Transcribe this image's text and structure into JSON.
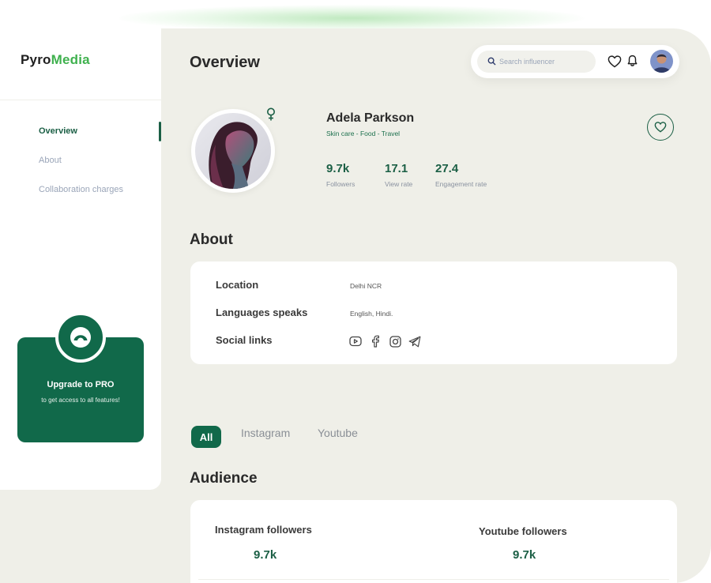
{
  "app": {
    "logo_part1": "Pyro",
    "logo_part2": "Media"
  },
  "sidebar": {
    "items": [
      {
        "label": "Overview",
        "active": true
      },
      {
        "label": "About",
        "active": false
      },
      {
        "label": "Collaboration  charges",
        "active": false
      }
    ],
    "promo": {
      "title": "Upgrade to PRO",
      "subtitle": "to get access to all features!",
      "icon": "logo-mark-icon"
    }
  },
  "header": {
    "title": "Overview",
    "search_placeholder": "Search influencer",
    "icons": [
      "search-icon",
      "heart-icon",
      "bell-icon",
      "avatar"
    ]
  },
  "profile": {
    "name": "Adela Parkson",
    "tags": "Skin care - Food - Travel",
    "gender_icon": "female-icon",
    "stats": [
      {
        "value": "9.7k",
        "label": "Followers"
      },
      {
        "value": "17.1",
        "label": "View rate"
      },
      {
        "value": "27.4",
        "label": "Engagement rate"
      }
    ]
  },
  "about": {
    "title": "About",
    "rows": [
      {
        "key": "Location",
        "value": "Delhi NCR"
      },
      {
        "key": "Languages speaks",
        "value": "English, Hindi."
      },
      {
        "key": "Social links",
        "value": ""
      }
    ],
    "social_icons": [
      "youtube-icon",
      "facebook-icon",
      "instagram-icon",
      "telegram-icon"
    ]
  },
  "tabs": [
    {
      "label": "All",
      "active": true
    },
    {
      "label": "Instagram",
      "active": false
    },
    {
      "label": "Youtube",
      "active": false
    }
  ],
  "audience": {
    "title": "Audience",
    "items": [
      {
        "label": "Instagram followers",
        "value": "9.7k"
      },
      {
        "label": "Youtube followers",
        "value": "9.7k"
      }
    ]
  },
  "colors": {
    "brand_green": "#11694a",
    "logo_green": "#3fb14e",
    "canvas": "#efefe8",
    "muted": "#9aa5b8"
  }
}
